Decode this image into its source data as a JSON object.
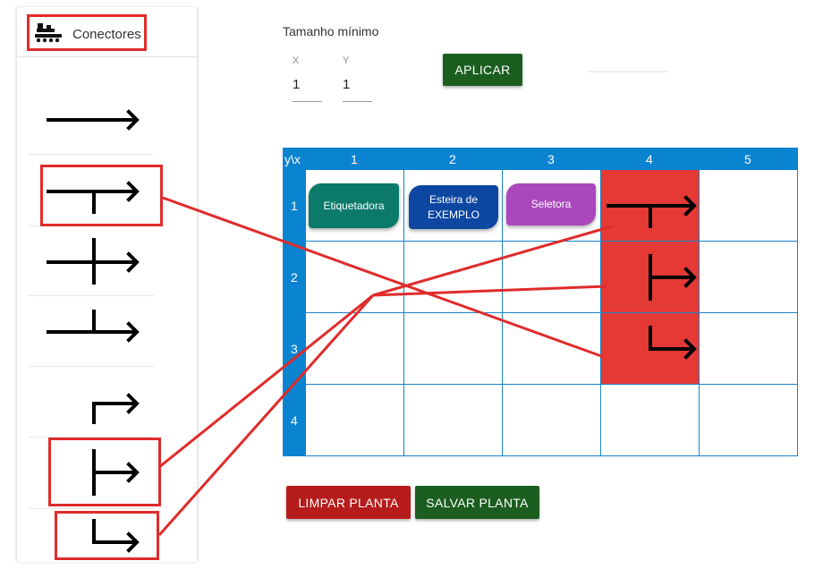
{
  "sidebar": {
    "title": "Conectores",
    "title_icon": "conveyor-icon",
    "connectors": [
      {
        "icon": "arrow-right-icon"
      },
      {
        "icon": "t-junction-down-arrow-icon"
      },
      {
        "icon": "cross-junction-arrow-icon"
      },
      {
        "icon": "t-junction-up-arrow-icon"
      },
      {
        "icon": "corner-up-right-arrow-icon"
      },
      {
        "icon": "branch-vertical-arrow-icon"
      },
      {
        "icon": "corner-down-right-arrow-icon"
      }
    ]
  },
  "size_form": {
    "label": "Tamanho mínimo",
    "x_label": "X",
    "x_value": "1",
    "y_label": "Y",
    "y_value": "1",
    "apply_label": "APLICAR"
  },
  "grid": {
    "corner": "y\\x",
    "columns": [
      "1",
      "2",
      "3",
      "4",
      "5"
    ],
    "rows": [
      "1",
      "2",
      "3",
      "4"
    ],
    "highlight_color": "#e53935",
    "header_color": "#0a84d0",
    "machines": [
      {
        "label": "Etiquetadora",
        "color": "#0c7a6b"
      },
      {
        "label": "Esteira de EXEMPLO",
        "color": "#0d47a1"
      },
      {
        "label": "Seletora",
        "color": "#ab47bc"
      }
    ],
    "placed_connectors": [
      {
        "icon": "t-junction-down-arrow-icon"
      },
      {
        "icon": "branch-vertical-arrow-icon"
      },
      {
        "icon": "corner-down-right-arrow-icon"
      }
    ]
  },
  "actions": {
    "clear_label": "LIMPAR PLANTA",
    "clear_color": "#b71c1c",
    "save_label": "SALVAR PLANTA",
    "save_color": "#1b5e20"
  },
  "annotation_color": "#e02b2b"
}
